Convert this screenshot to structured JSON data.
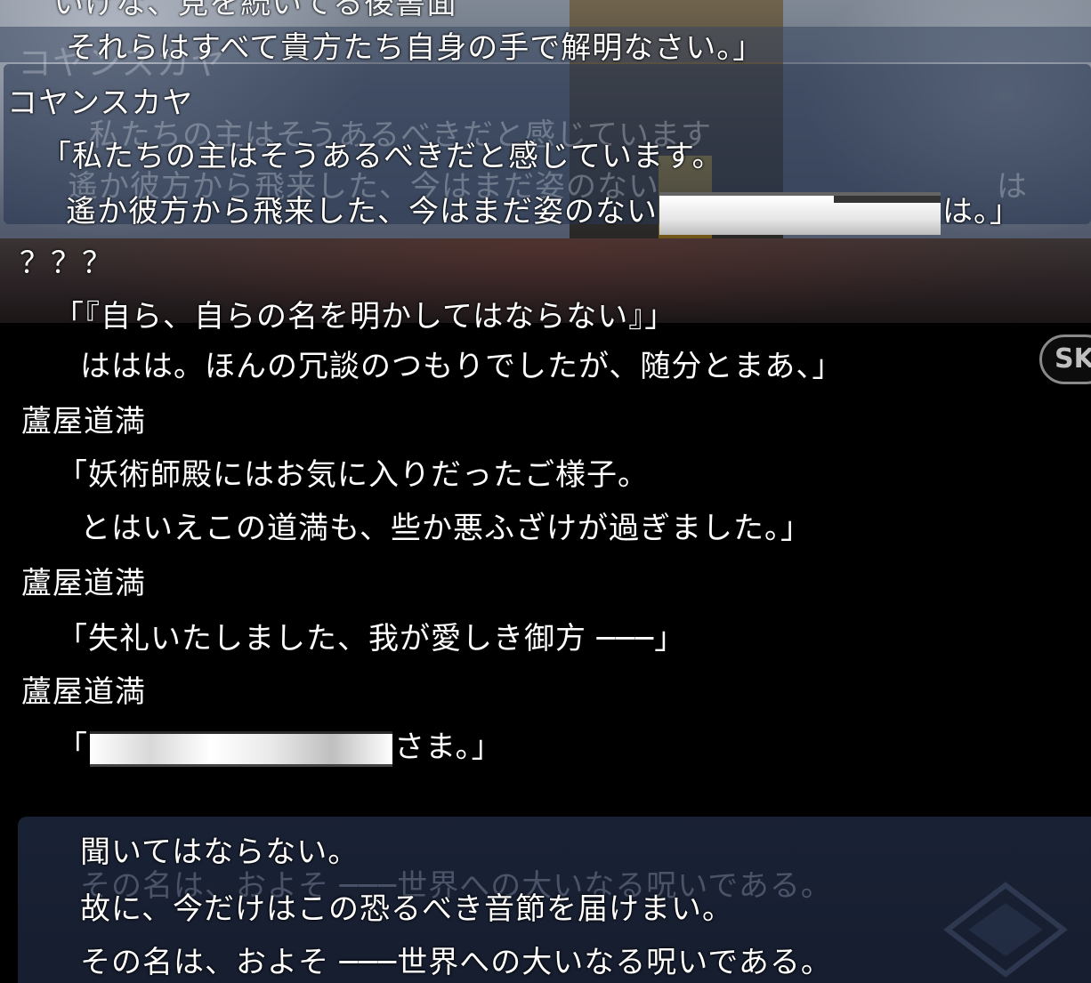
{
  "backlog": {
    "top_ghost_partial": "いけな、見を続いてる後書面",
    "ghost_header_name": "コヤンスカヤ",
    "entries": [
      {
        "lines": [
          "それらはすべて貴方たち自身の手で解明なさい。」"
        ]
      },
      {
        "speaker": "コヤンスカヤ",
        "lines": [
          "「私たちの主はそうあるべきだと感じています。",
          "遙か彼方から飛来した、今はまだ姿のない",
          "は。」"
        ],
        "ghost_lines": [
          "私たちの主はそうあるべきだと感じています",
          "遙か彼方から飛来した、今はまだ姿のない",
          "は"
        ]
      },
      {
        "speaker": "？？？",
        "lines": [
          "「『自ら、自らの名を明かしてはならない』」"
        ]
      },
      {
        "lines": [
          "ははは。ほんの冗談のつもりでしたが、随分とまあ、」"
        ]
      },
      {
        "speaker": "蘆屋道満",
        "lines": [
          "「妖術師殿にはお気に入りだったご様子。",
          "とはいえこの道満も、些か悪ふざけが過ぎました。」"
        ]
      },
      {
        "speaker": "蘆屋道満",
        "lines": [
          "「失礼いたしました、我が愛しき御方 ───」"
        ]
      },
      {
        "speaker": "蘆屋道満",
        "lines": [
          "「",
          "さま。」"
        ]
      }
    ]
  },
  "skip_button": {
    "label": "SK"
  },
  "narration": {
    "lines": [
      "聞いてはならない。",
      "故に、今だけはこの恐るべき音節を届けまい。",
      "その名は、およそ ───世界への大いなる呪いである。"
    ],
    "ghost_line": "その名は、およそ ───世界への大いなる呪いである。"
  },
  "colors": {
    "text": "#ffffff",
    "panel": "#2b3a55",
    "narration_bg": "#1a2236",
    "background": "#000000"
  }
}
